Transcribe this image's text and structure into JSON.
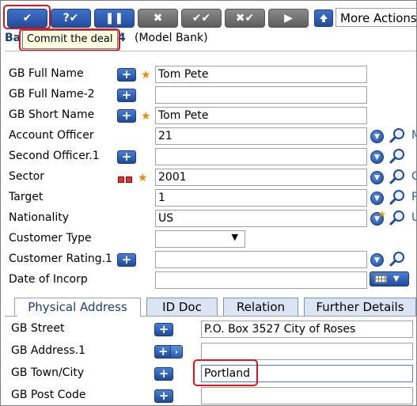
{
  "toolbar": {
    "buttons": [
      {
        "name": "commit-button",
        "glyph": "✔",
        "style": "blue"
      },
      {
        "name": "validate-button",
        "glyph": "?✔",
        "style": "blue"
      },
      {
        "name": "hold-button",
        "glyph": "❚❚",
        "style": "blue"
      },
      {
        "name": "delete-button",
        "glyph": "✖",
        "style": "grey"
      },
      {
        "name": "authorise-button",
        "glyph": "✔✔",
        "style": "grey"
      },
      {
        "name": "reverse-button",
        "glyph": "✖✔",
        "style": "grey"
      },
      {
        "name": "next-button",
        "glyph": "▶",
        "style": "grey"
      }
    ],
    "more_actions": "More Actions",
    "tooltip": "Commit the deal"
  },
  "header": {
    "prefix": "Ba",
    "number_tail": "4",
    "bank": "(Model Bank)"
  },
  "form": {
    "gb_full_name": {
      "label": "GB Full Name",
      "value": "Tom Pete"
    },
    "gb_full_name_2": {
      "label": "GB Full Name-2",
      "value": ""
    },
    "gb_short_name": {
      "label": "GB Short Name",
      "value": "Tom Pete"
    },
    "account_officer": {
      "label": "Account Officer",
      "value": "21",
      "side": "M"
    },
    "second_officer": {
      "label": "Second Officer.1",
      "value": ""
    },
    "sector": {
      "label": "Sector",
      "value": "2001",
      "side": "C"
    },
    "target": {
      "label": "Target",
      "value": "1",
      "side": "P"
    },
    "nationality": {
      "label": "Nationality",
      "value": "US",
      "side": "U"
    },
    "customer_type": {
      "label": "Customer Type",
      "value": ""
    },
    "customer_rating": {
      "label": "Customer Rating.1",
      "value": ""
    },
    "date_of_incorp": {
      "label": "Date of Incorp",
      "value": ""
    }
  },
  "tabs": [
    "Physical Address",
    "ID Doc",
    "Relation",
    "Further Details"
  ],
  "address": {
    "gb_street": {
      "label": "GB Street",
      "value": "P.O. Box 3527 City of Roses"
    },
    "gb_address_1": {
      "label": "GB Address.1",
      "value": ""
    },
    "gb_town_city": {
      "label": "GB Town/City",
      "value": "Portland"
    },
    "gb_post_code": {
      "label": "GB Post Code",
      "value": ""
    }
  }
}
